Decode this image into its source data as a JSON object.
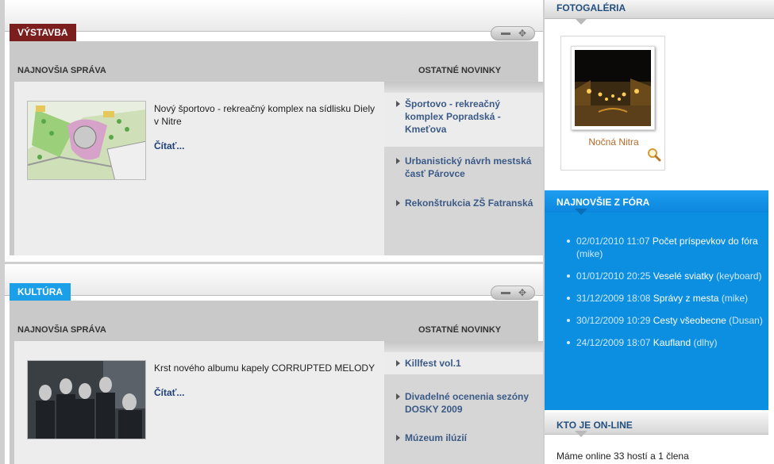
{
  "vystavba": {
    "tag": "VÝSTAVBA",
    "latest_label": "NAJNOVŠIA SPRÁVA",
    "other_label": "OSTATNÉ NOVINKY",
    "main_title": "Nový športovo - rekreačný komplex na sídlisku Diely v Nitre",
    "read_more": "Čítať...",
    "others": [
      "Športovo - rekreačný komplex Popradská - Kmeťova",
      "Urbanistický návrh mestská časť Párovce",
      "Rekonštrukcia ZŠ Fatranská"
    ]
  },
  "kultura": {
    "tag": "KULTÚRA",
    "latest_label": "NAJNOVŠIA SPRÁVA",
    "other_label": "OSTATNÉ NOVINKY",
    "main_title": "Krst nového albumu kapely CORRUPTED MELODY",
    "read_more": "Čítať...",
    "others": [
      "Killfest vol.1",
      "Divadelné ocenenia sezóny DOSKY 2009",
      "Múzeum ilúzií"
    ]
  },
  "sidebar": {
    "gallery_title": "FOTOGALÉRIA",
    "photo_caption": "Nočná Nitra",
    "forum_title": "NAJNOVŠIE Z FÓRA",
    "forum_items": [
      {
        "date": "02/01/2010 11:07",
        "title": "Počet príspevkov do fóra",
        "user": "(mike)"
      },
      {
        "date": "01/01/2010 20:25",
        "title": "Veselé sviatky",
        "user": "(keyboard)"
      },
      {
        "date": "31/12/2009 18:08",
        "title": "Správy z mesta",
        "user": "(mike)"
      },
      {
        "date": "30/12/2009 10:29",
        "title": "Cesty všeobecne",
        "user": "(Dusan)"
      },
      {
        "date": "24/12/2009 18:07",
        "title": "Kaufland",
        "user": "(dlhy)"
      }
    ],
    "online_title": "KTO JE ON-LINE",
    "online_text": "Máme online 33 hostí a 1 člena"
  },
  "colors": {
    "vystavba_accent": "#7a1e1e",
    "kultura_accent": "#1a9fe8",
    "forum_bg": "#0c8fe0",
    "link": "#3b5a86"
  },
  "icons": {
    "minimize": "minus-icon",
    "move": "move-icon",
    "zoom": "magnifier-icon",
    "bullet": "triangle-bullet-icon"
  }
}
